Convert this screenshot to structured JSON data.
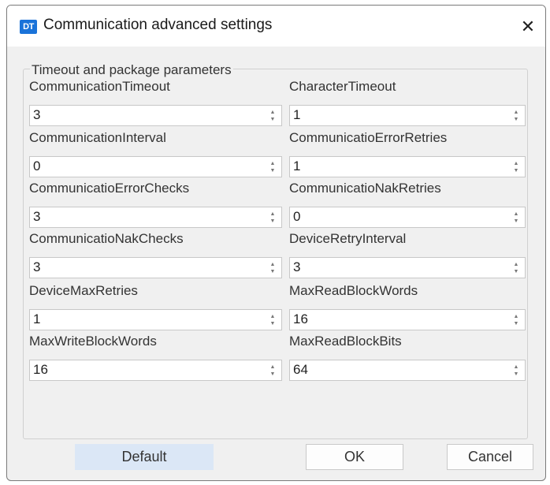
{
  "window": {
    "icon_text": "DT",
    "title": "Communication advanced settings",
    "close_glyph": "✕"
  },
  "group": {
    "title": "Timeout and package parameters"
  },
  "fields": [
    {
      "label": "CommunicationTimeout",
      "value": "3"
    },
    {
      "label": "CharacterTimeout",
      "value": "1"
    },
    {
      "label": "CommunicationInterval",
      "value": "0"
    },
    {
      "label": "CommunicatioErrorRetries",
      "value": "1"
    },
    {
      "label": "CommunicatioErrorChecks",
      "value": "3"
    },
    {
      "label": "CommunicatioNakRetries",
      "value": "0"
    },
    {
      "label": "CommunicatioNakChecks",
      "value": "3"
    },
    {
      "label": "DeviceRetryInterval",
      "value": "3"
    },
    {
      "label": "DeviceMaxRetries",
      "value": "1"
    },
    {
      "label": "MaxReadBlockWords",
      "value": "16"
    },
    {
      "label": "MaxWriteBlockWords",
      "value": "16"
    },
    {
      "label": "MaxReadBlockBits",
      "value": "64"
    }
  ],
  "buttons": {
    "default": "Default",
    "ok": "OK",
    "cancel": "Cancel"
  },
  "icons": {
    "app": "app-logo-icon",
    "close": "close-icon",
    "spin_up": "spin-up-icon",
    "spin_down": "spin-down-icon"
  },
  "colors": {
    "dialog_bg": "#f0f0f0",
    "default_button_bg": "#dbe7f6",
    "app_icon": "#1a73d9"
  }
}
